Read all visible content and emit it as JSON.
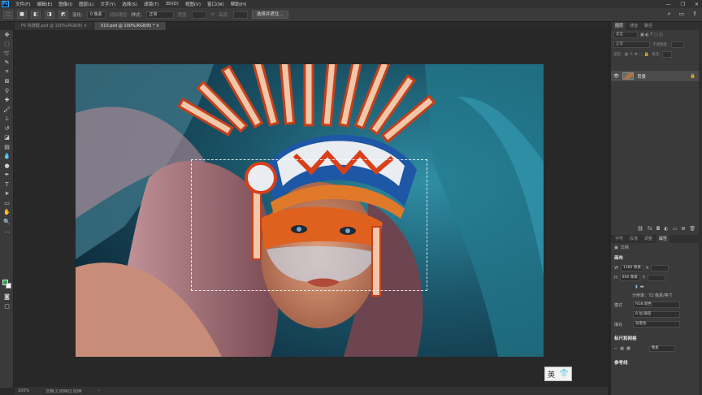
{
  "menubar": {
    "logo": "Ps",
    "items": [
      "文件(F)",
      "编辑(E)",
      "图像(I)",
      "图层(L)",
      "文字(Y)",
      "选择(S)",
      "滤镜(T)",
      "3D(D)",
      "视图(V)",
      "窗口(W)",
      "帮助(H)"
    ],
    "controls": [
      "—",
      "❐",
      "✕"
    ]
  },
  "options": {
    "feather_label": "羽化:",
    "feather_value": "0 像素",
    "antialias_label": "消除锯齿",
    "style_label": "样式:",
    "style_value": "正常",
    "width_label": "宽度:",
    "height_label": "高度:",
    "select_mask_button": "选择并遮住..."
  },
  "tabs": [
    {
      "label": "PS 快捷键.psd @ 100%(RGB/8) ×"
    },
    {
      "label": "010.psd @ 100%(RGB/8) * ×"
    }
  ],
  "status": {
    "zoom": "100%",
    "doc_size": "文档:2.93M/2.93M"
  },
  "ime": {
    "lang": "英",
    "icon": "shirt-icon"
  },
  "layers_panel": {
    "tabs": [
      "图层",
      "通道",
      "路径"
    ],
    "kind_filter": "类型",
    "blend_mode": "正常",
    "opacity_label": "不透明度:",
    "lock_label": "锁定:",
    "fill_label": "填充:",
    "layer_name": "背景"
  },
  "properties_panel": {
    "tabs": [
      "字符",
      "段落",
      "调整",
      "属性"
    ],
    "doc_label": "文档",
    "canvas_section": "画布",
    "w_label": "W",
    "w_value": "1280 像素",
    "h_label": "H",
    "h_value": "800 像素",
    "x_label": "X",
    "y_label": "Y",
    "resolution": "分辨率：72 像素/英寸",
    "mode_label": "模式",
    "mode_value": "RGB 颜色",
    "depth_value": "8 位/通道",
    "fill_label": "填充",
    "fill_value": "背景色",
    "rulers_section": "标尺和网格",
    "ruler_unit": "像素",
    "guides_section": "参考线"
  },
  "colors": {
    "foreground": "#1ea84a",
    "background": "#ffffff"
  }
}
